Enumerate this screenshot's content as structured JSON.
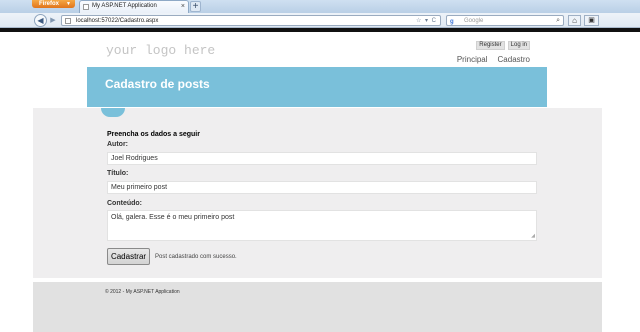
{
  "browser": {
    "app_button": "Firefox",
    "tab_title": "My ASP.NET Application",
    "new_tab": "+",
    "url": "localhost:57022/Cadastro.aspx",
    "search_placeholder": "Google",
    "back_icon": "back-arrow-icon",
    "forward_icon": "forward-arrow-icon",
    "home_icon": "home-icon"
  },
  "site": {
    "logo": "your logo here",
    "login": {
      "register": "Register",
      "login": "Log in"
    },
    "menu": [
      {
        "label": "Principal"
      },
      {
        "label": "Cadastro"
      }
    ],
    "featured_title": "Cadastro de posts"
  },
  "form": {
    "legend": "Preencha os dados a seguir",
    "author_label": "Autor:",
    "author_value": "Joel Rodrigues",
    "title_label": "Título:",
    "title_value": "Meu primeiro post",
    "content_label": "Conteúdo:",
    "content_value": "Olá, galera. Esse é o meu primeiro post",
    "submit_label": "Cadastrar",
    "success_message": "Post cadastrado com sucesso."
  },
  "footer": {
    "copyright": "© 2012 - My ASP.NET Application"
  },
  "colors": {
    "accent": "#7ac0da",
    "main_bg": "#efeeef",
    "footer_bg": "#e1e1e1"
  }
}
